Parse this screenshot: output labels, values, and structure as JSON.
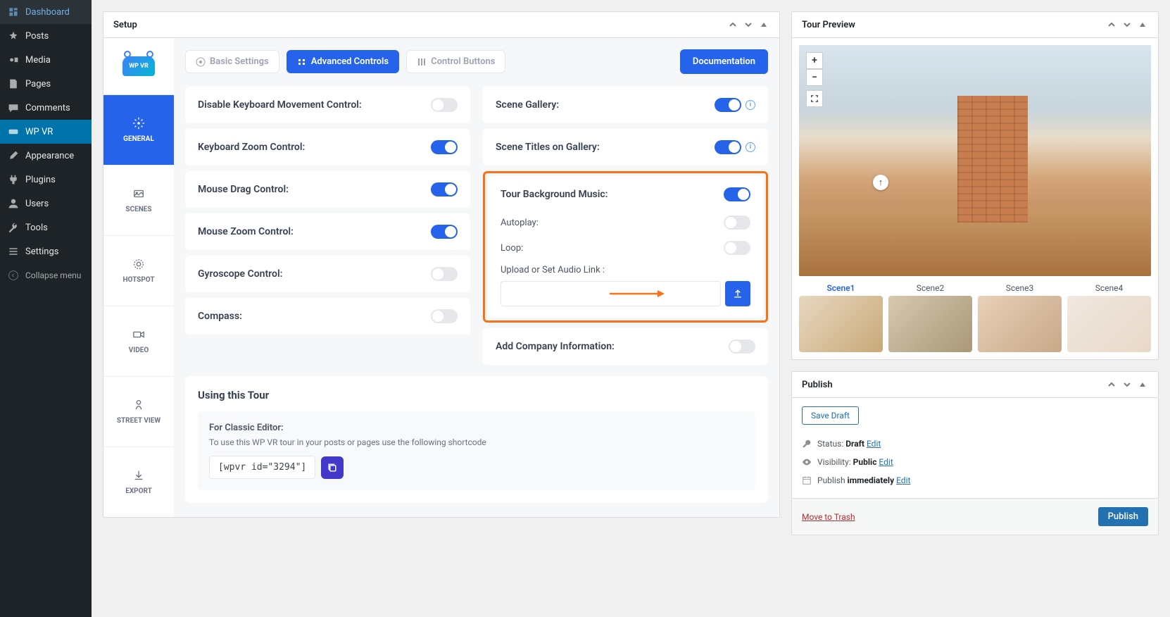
{
  "wp_sidebar": {
    "dashboard": "Dashboard",
    "posts": "Posts",
    "media": "Media",
    "pages": "Pages",
    "comments": "Comments",
    "wpvr": "WP VR",
    "appearance": "Appearance",
    "plugins": "Plugins",
    "users": "Users",
    "tools": "Tools",
    "settings": "Settings",
    "collapse": "Collapse menu"
  },
  "setup": {
    "title": "Setup",
    "side_tabs": {
      "general": "GENERAL",
      "scenes": "SCENES",
      "hotspot": "HOTSPOT",
      "video": "VIDEO",
      "street_view": "STREET VIEW",
      "export": "EXPORT"
    },
    "top_tabs": {
      "basic": "Basic Settings",
      "advanced": "Advanced Controls",
      "control_buttons": "Control Buttons"
    },
    "doc_btn": "Documentation",
    "left_settings": {
      "disable_keyboard": "Disable Keyboard Movement Control:",
      "keyboard_zoom": "Keyboard Zoom Control:",
      "mouse_drag": "Mouse Drag Control:",
      "mouse_zoom": "Mouse Zoom Control:",
      "gyroscope": "Gyroscope Control:",
      "compass": "Compass:"
    },
    "right_settings": {
      "scene_gallery": "Scene Gallery:",
      "scene_titles": "Scene Titles on Gallery:",
      "bg_music": "Tour Background Music:",
      "autoplay": "Autoplay:",
      "loop": "Loop:",
      "upload_audio": "Upload or Set Audio Link :",
      "company_info": "Add Company Information:"
    },
    "using": {
      "title": "Using this Tour",
      "classic_title": "For Classic Editor:",
      "classic_desc": "To use this WP VR tour in your posts or pages use the following shortcode",
      "shortcode": "[wpvr id=\"3294\"]"
    }
  },
  "preview": {
    "title": "Tour Preview",
    "zoom_in": "+",
    "zoom_out": "−",
    "scenes": [
      "Scene1",
      "Scene2",
      "Scene3",
      "Scene4"
    ]
  },
  "publish": {
    "title": "Publish",
    "save_draft": "Save Draft",
    "status_label": "Status:",
    "status_value": "Draft",
    "visibility_label": "Visibility:",
    "visibility_value": "Public",
    "schedule_label": "Publish",
    "schedule_value": "immediately",
    "edit": "Edit",
    "trash": "Move to Trash",
    "publish_btn": "Publish"
  }
}
